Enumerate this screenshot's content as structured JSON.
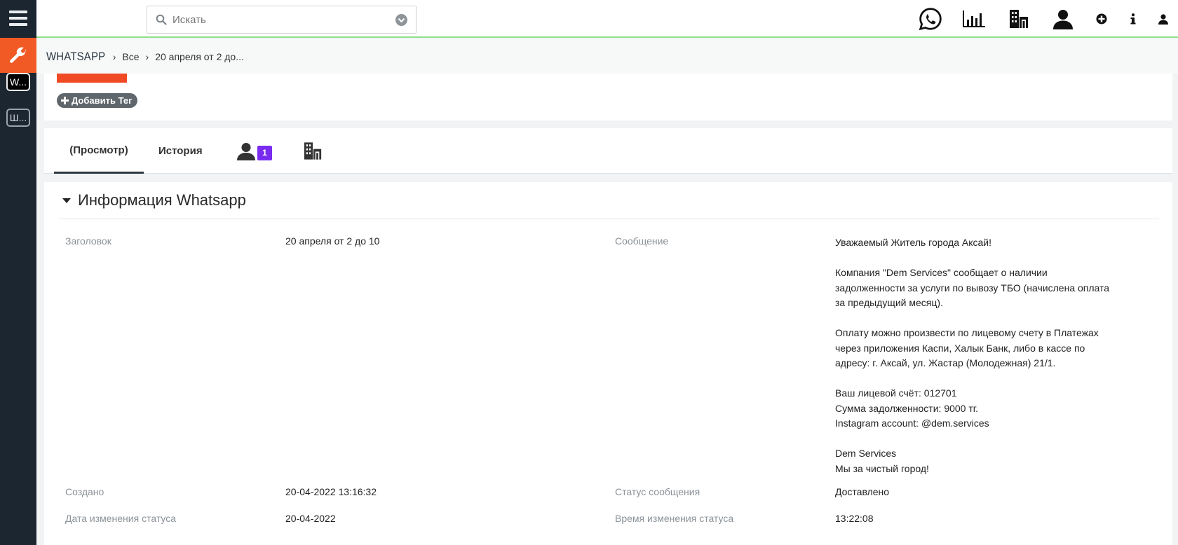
{
  "search": {
    "placeholder": "Искать"
  },
  "sidebar": {
    "pills": [
      {
        "label": "W..."
      },
      {
        "label": "Ш..."
      }
    ]
  },
  "breadcrumb": {
    "app": "WHATSAPP",
    "items": [
      "Все",
      "20 апреля от 2 до..."
    ]
  },
  "tags": {
    "add_label": "Добавить Тег"
  },
  "tabs": [
    {
      "label": "(Просмотр)",
      "active": true
    },
    {
      "label": "История",
      "active": false
    }
  ],
  "users_tab": {
    "badge": "1"
  },
  "panel": {
    "title": "Информация Whatsapp",
    "fields": {
      "title_label": "Заголовок",
      "title_value": "20 апреля от 2 до 10",
      "message_label": "Сообщение",
      "created_label": "Создано",
      "created_value": "20-04-2022 13:16:32",
      "status_label": "Статус сообщения",
      "status_value": "Доставлено",
      "status_date_label": "Дата изменения статуса",
      "status_date_value": "20-04-2022",
      "status_time_label": "Время изменения статуса",
      "status_time_value": "13:22:08"
    },
    "message": {
      "line1": "Уважаемый Житель города Аксай!",
      "line2": "Компания \"Dem Services\" сообщает о наличии задолженности за услуги по вывозу ТБО (начислена оплата за предыдущий месяц).",
      "line3": "Оплату можно произвести по лицевому счету в Платежах через приложения Каспи, Халык Банк, либо в кассе по адресу: г. Аксай, ул. Жастар (Молодежная) 21/1.",
      "line4a": "Ваш лицевой счёт: 012701",
      "line4b": "Сумма задолженности: 9000 тг.",
      "line4c": "Instagram account: @dem.services",
      "line5a": "Dem Services",
      "line5b": "Мы за чистый город!"
    }
  },
  "colors": {
    "sidebar_bg": "#1b2631",
    "accent_orange": "#f15a24",
    "badge_purple": "#7a2bf0",
    "header_underline": "#8ee08e"
  }
}
